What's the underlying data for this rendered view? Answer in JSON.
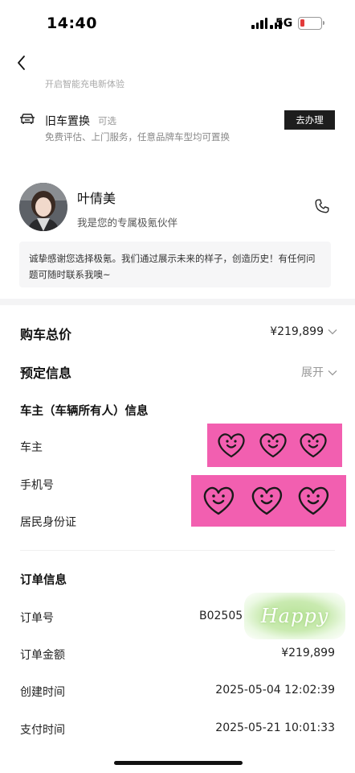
{
  "status_bar": {
    "time": "14:40",
    "network": "5G"
  },
  "header": {
    "faded_text": "开启智能充电新体验"
  },
  "trade_in": {
    "title": "旧车置换",
    "optional": "可选",
    "description": "免费评估、上门服务，任意品牌车型均可置换",
    "button": "去办理"
  },
  "advisor": {
    "name": "叶倩美",
    "role": "我是您的专属极氪伙伴",
    "message": "诚挚感谢您选择极氪。我们通过展示未来的样子，创造历史！有任何问题可随时联系我噢~"
  },
  "total_price": {
    "label": "购车总价",
    "value": "¥219,899"
  },
  "booking": {
    "label": "预定信息",
    "toggle": "展开"
  },
  "owner": {
    "section_title": "车主（车辆所有人）信息",
    "name_label": "车主",
    "phone_label": "手机号",
    "id_label": "居民身份证"
  },
  "order": {
    "section_title": "订单信息",
    "number_label": "订单号",
    "number_value": "B02505",
    "amount_label": "订单金额",
    "amount_value": "¥219,899",
    "created_label": "创建时间",
    "created_value": "2025-05-04 12:02:39",
    "paid_label": "支付时间",
    "paid_value": "2025-05-21 10:01:33"
  },
  "sticker_text": "Happy",
  "colors": {
    "sticker_pink": "#f25fb0",
    "battery_low": "#e23b3b",
    "button_dark": "#1d1d1d"
  }
}
